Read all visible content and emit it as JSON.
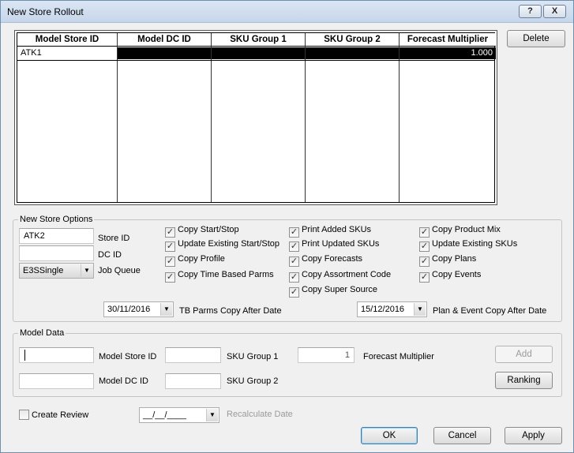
{
  "window": {
    "title": "New Store Rollout",
    "help_label": "?",
    "close_label": "X"
  },
  "grid": {
    "columns": [
      "Model Store ID",
      "Model DC ID",
      "SKU Group 1",
      "SKU Group 2",
      "Forecast Multiplier"
    ],
    "rows": [
      {
        "model_store_id": "ATK1",
        "model_dc_id": "",
        "sku_group_1": "",
        "sku_group_2": "",
        "forecast_multiplier": "1.000"
      }
    ]
  },
  "buttons": {
    "delete": "Delete",
    "add": "Add",
    "ranking": "Ranking",
    "ok": "OK",
    "cancel": "Cancel",
    "apply": "Apply"
  },
  "options": {
    "group_label": "New Store Options",
    "store_id_value": "ATK2",
    "store_id_label": "Store ID",
    "dc_id_value": "",
    "dc_id_label": "DC ID",
    "job_queue_value": "E3SSingle",
    "job_queue_label": "Job Queue",
    "checks_col1": [
      {
        "label": "Copy Start/Stop",
        "checked": true
      },
      {
        "label": "Update Existing Start/Stop",
        "checked": true
      },
      {
        "label": "Copy Profile",
        "checked": true
      },
      {
        "label": "Copy Time Based Parms",
        "checked": true
      }
    ],
    "checks_col2": [
      {
        "label": "Print Added SKUs",
        "checked": true
      },
      {
        "label": "Print Updated SKUs",
        "checked": true
      },
      {
        "label": "Copy Forecasts",
        "checked": true
      },
      {
        "label": "Copy Assortment Code",
        "checked": true
      },
      {
        "label": "Copy Super Source",
        "checked": true
      }
    ],
    "checks_col3": [
      {
        "label": "Copy Product Mix",
        "checked": true
      },
      {
        "label": "Update Existing SKUs",
        "checked": true
      },
      {
        "label": "Copy Plans",
        "checked": true
      },
      {
        "label": "Copy Events",
        "checked": true
      }
    ],
    "tb_date_value": "30/11/2016",
    "tb_date_label": "TB Parms Copy After Date",
    "plan_date_value": "15/12/2016",
    "plan_date_label": "Plan & Event Copy After Date"
  },
  "model_data": {
    "group_label": "Model Data",
    "model_store_id_value": "",
    "model_store_id_label": "Model Store ID",
    "model_dc_id_value": "",
    "model_dc_id_label": "Model DC ID",
    "sku_group_1_value": "",
    "sku_group_1_label": "SKU Group 1",
    "sku_group_2_value": "",
    "sku_group_2_label": "SKU Group 2",
    "forecast_multiplier_value": "1",
    "forecast_multiplier_label": "Forecast Multiplier"
  },
  "footer": {
    "create_review_label": "Create Review",
    "create_review_checked": false,
    "recalc_date_value": "__/__/____",
    "recalc_date_label": "Recalculate Date"
  },
  "check_glyph": "✓"
}
